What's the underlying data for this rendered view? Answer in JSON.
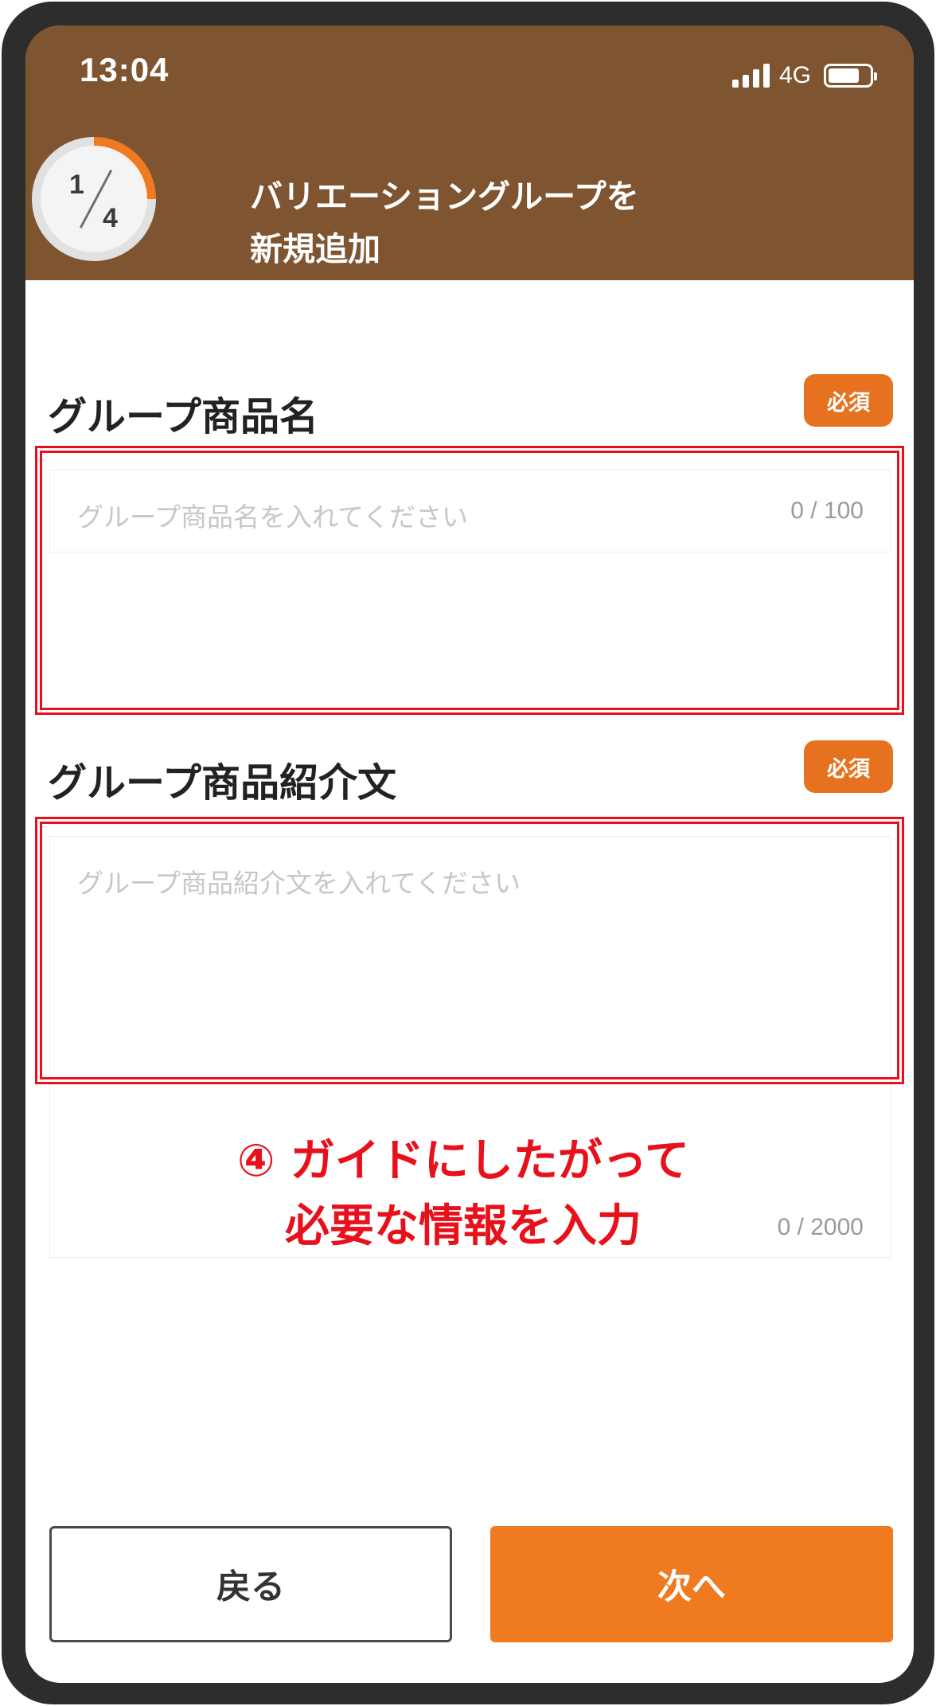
{
  "status_bar": {
    "time": "13:04",
    "network": "4G"
  },
  "header": {
    "step_current": "1",
    "step_total": "4",
    "step_progress_fraction": 0.25,
    "title_line1": "バリエーショングループを",
    "title_line2": "新規追加",
    "background_color": "#7e5530"
  },
  "fields": [
    {
      "label": "グループ商品名",
      "badge": "必須",
      "placeholder": "グループ商品名を入れてください",
      "counter": "0 / 100"
    },
    {
      "label": "グループ商品紹介文",
      "badge": "必須",
      "placeholder": "グループ商品紹介文を入れてください",
      "counter": "0 / 2000"
    }
  ],
  "annotation": {
    "line1": "④ ガイドにしたがって",
    "line2": "必要な情報を入力",
    "color": "#e8111b"
  },
  "buttons": {
    "back": "戻る",
    "next": "次へ",
    "accent_color": "#f07a1f"
  }
}
